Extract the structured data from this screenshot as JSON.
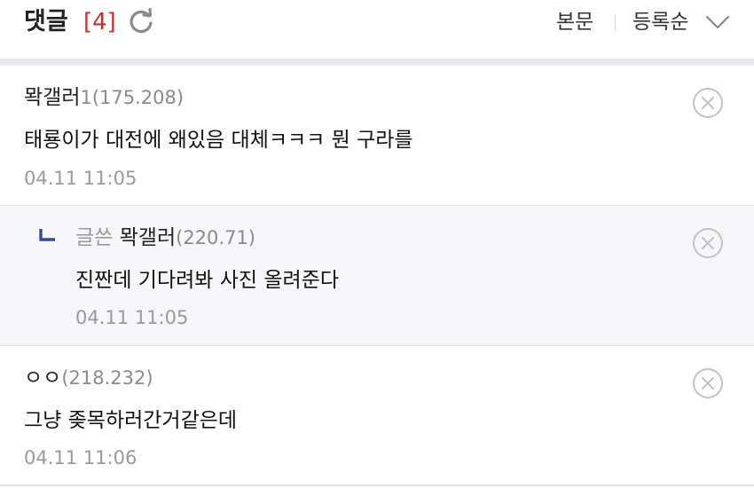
{
  "header": {
    "title": "댓글",
    "count": "[4]",
    "main_label": "본문",
    "sort_label": "등록순"
  },
  "comments": [
    {
      "nick": "뫅갤러",
      "nick_suffix": "1",
      "ip": "(175.208)",
      "text": "태룡이가 대전에 왜있음 대체ㅋㅋㅋ 뭔 구라를",
      "date": "04.11 11:05"
    },
    {
      "op_tag": "글쓴",
      "nick": "뫅갤러",
      "ip": "(220.71)",
      "text": "진짠데 기다려봐 사진 올려준다",
      "date": "04.11 11:05"
    },
    {
      "nick": "ㅇㅇ",
      "ip": "(218.232)",
      "text": "그냥 좆목하러간거같은데",
      "date": "04.11 11:06"
    }
  ],
  "colors": {
    "count_red": "#c4302b",
    "reply_bg": "#f5f6f9",
    "reply_mark": "#3b4a8c"
  }
}
